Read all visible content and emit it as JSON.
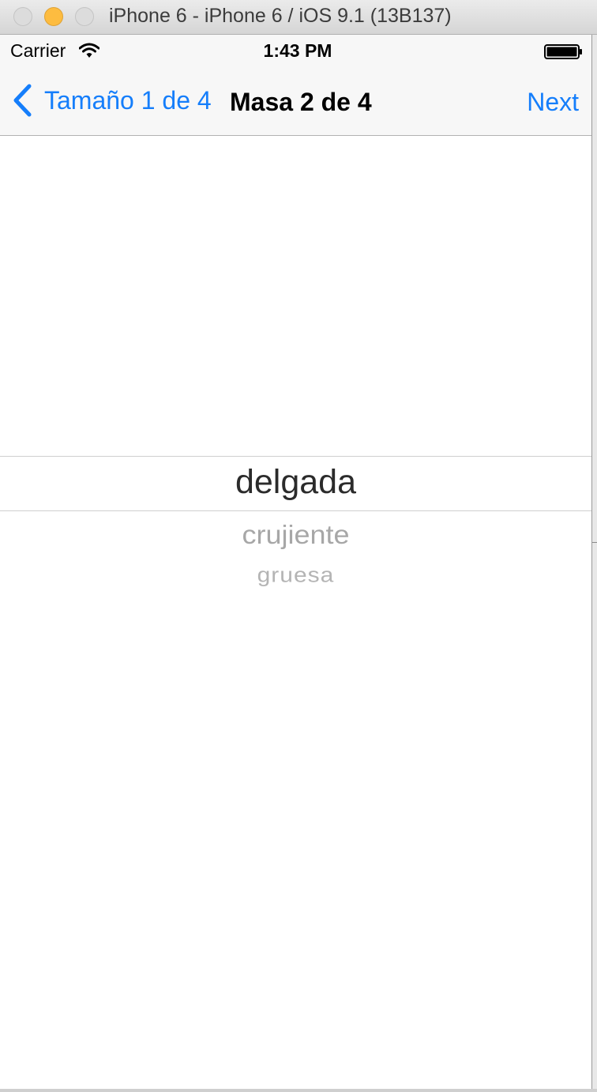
{
  "window": {
    "title": "iPhone 6 - iPhone 6 / iOS 9.1 (13B137)"
  },
  "status_bar": {
    "carrier": "Carrier",
    "time": "1:43 PM",
    "icons": [
      "wifi-icon",
      "battery-icon"
    ]
  },
  "nav_bar": {
    "back_label": "Tamaño 1 de 4",
    "title": "Masa 2 de 4",
    "next_label": "Next",
    "accent_color": "#157efb"
  },
  "picker": {
    "selected": "delgada",
    "options": [
      "delgada",
      "crujiente",
      "gruesa"
    ],
    "below": [
      "crujiente",
      "gruesa"
    ]
  }
}
